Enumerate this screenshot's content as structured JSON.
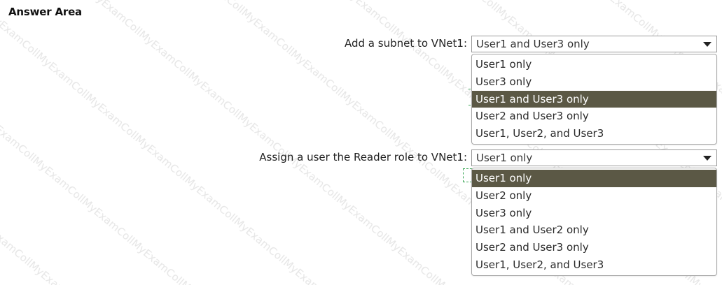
{
  "answer_area": {
    "title": "Answer Area"
  },
  "questions": [
    {
      "label": "Add a subnet to VNet1:",
      "selected_value": "User1 and User3 only",
      "options": [
        "User1 only",
        "User3 only",
        "User1 and User3 only",
        "User2 and User3 only",
        "User1, User2, and User3"
      ],
      "highlighted_index": 2
    },
    {
      "label": "Assign a user the Reader role to VNet1:",
      "selected_value": "User1 only",
      "options": [
        "User1 only",
        "User2 only",
        "User3 only",
        "User1 and User2 only",
        "User2 and User3 only",
        "User1, User2, and User3"
      ],
      "highlighted_index": 0
    }
  ],
  "watermark": {
    "text": "MyExamCollection",
    "color": "#e6e6e6"
  },
  "colors": {
    "highlight_bg": "#5b5845",
    "highlight_text": "#ffffff",
    "dashed_marker": "#3aa655"
  }
}
